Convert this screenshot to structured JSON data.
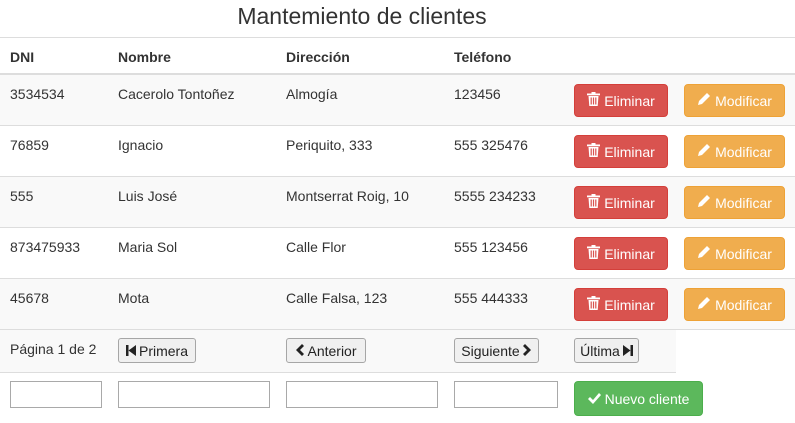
{
  "page": {
    "title": "Mantemiento de clientes"
  },
  "table": {
    "headers": {
      "dni": "DNI",
      "nombre": "Nombre",
      "direccion": "Dirección",
      "telefono": "Teléfono"
    },
    "rows": [
      {
        "dni": "3534534",
        "nombre": "Cacerolo Tontoñez",
        "direccion": "Almogía",
        "telefono": "123456"
      },
      {
        "dni": "76859",
        "nombre": "Ignacio",
        "direccion": "Periquito, 333",
        "telefono": "555 325476"
      },
      {
        "dni": "555",
        "nombre": "Luis José",
        "direccion": "Montserrat Roig, 10",
        "telefono": "5555 234233"
      },
      {
        "dni": "873475933",
        "nombre": "Maria Sol",
        "direccion": "Calle Flor",
        "telefono": "555 123456"
      },
      {
        "dni": "45678",
        "nombre": "Mota",
        "direccion": "Calle Falsa, 123",
        "telefono": "555 444333"
      }
    ],
    "actions": {
      "delete_label": "Eliminar",
      "edit_label": "Modificar"
    }
  },
  "pagination": {
    "status": "Página 1 de 2",
    "first_label": "Primera",
    "prev_label": "Anterior",
    "next_label": "Siguiente",
    "last_label": "Última"
  },
  "new_client": {
    "dni_value": "",
    "nombre_value": "",
    "direccion_value": "",
    "telefono_value": "",
    "button_label": "Nuevo cliente"
  },
  "colors": {
    "delete": "#d9534f",
    "edit": "#f0ad4e",
    "new": "#5cb85c",
    "stripe": "#f9f9f9",
    "border": "#dddddd"
  }
}
